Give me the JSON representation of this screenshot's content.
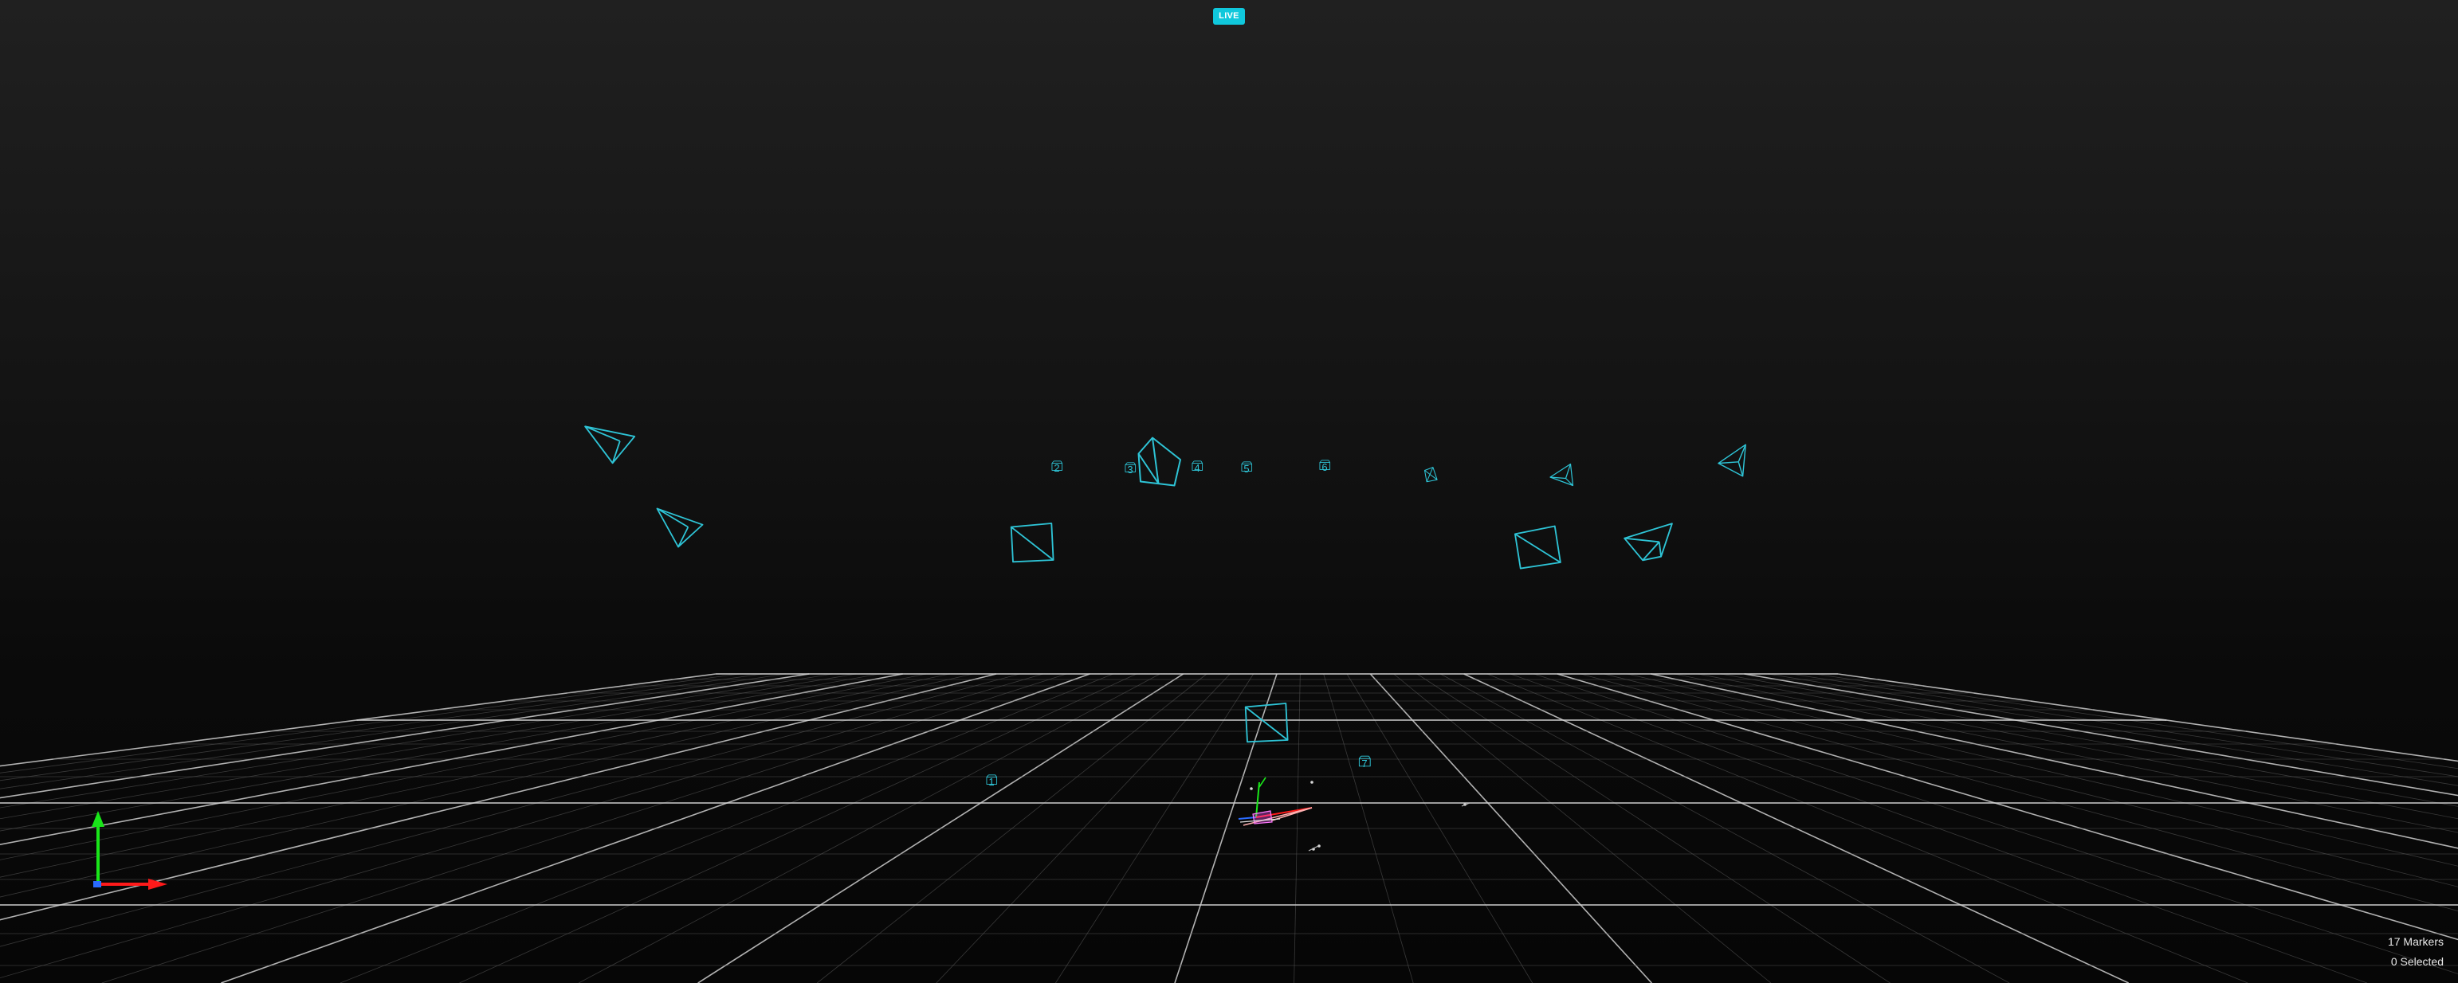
{
  "viewport": {
    "live_label": "LIVE",
    "markers_label": "17 Markers",
    "selected_label": "0 Selected"
  },
  "cameras": [
    {
      "id": "cam-a",
      "label": ""
    },
    {
      "id": "cam-b",
      "label": ""
    },
    {
      "id": "cam-2",
      "label": "2"
    },
    {
      "id": "cam-3",
      "label": "3"
    },
    {
      "id": "cam-big-upper",
      "label": ""
    },
    {
      "id": "cam-4",
      "label": "4"
    },
    {
      "id": "cam-5",
      "label": "5"
    },
    {
      "id": "cam-6",
      "label": "6"
    },
    {
      "id": "cam-c",
      "label": ""
    },
    {
      "id": "cam-d",
      "label": ""
    },
    {
      "id": "cam-e",
      "label": ""
    },
    {
      "id": "cam-f",
      "label": ""
    },
    {
      "id": "cam-g",
      "label": ""
    },
    {
      "id": "cam-h",
      "label": ""
    },
    {
      "id": "cam-floor",
      "label": ""
    },
    {
      "id": "cam-1",
      "label": "1"
    },
    {
      "id": "cam-7",
      "label": "7"
    }
  ],
  "colors": {
    "camera": "#2ec4d6",
    "live_badge": "#10c8dc",
    "grid_major": "#d0d0d0",
    "grid_minor": "#5a5a5a",
    "axis_x": "#ff1a1a",
    "axis_y": "#19e619",
    "axis_z": "#2a6bff"
  },
  "icons": {
    "orientation_gizmo": "xyz-axes-icon",
    "camera": "camera-frustum-icon"
  }
}
